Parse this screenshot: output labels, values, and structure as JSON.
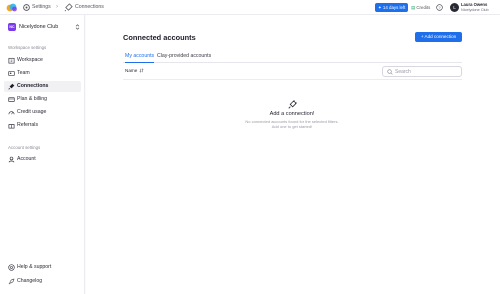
{
  "topbar": {
    "breadcrumb": [
      {
        "label": "Settings",
        "icon": "gear-icon"
      },
      {
        "label": "Connections",
        "icon": "plug-icon"
      }
    ],
    "days_left": "14 days left",
    "credits": "Credits",
    "user": {
      "initial": "L",
      "name": "Laura Owens",
      "org": "Nicelydone Club"
    }
  },
  "sidebar": {
    "workspace": {
      "badge": "NC",
      "name": "Nicelydone Club"
    },
    "workspace_section": "Workspace settings",
    "workspace_items": [
      {
        "label": "Workspace",
        "icon": "building-icon"
      },
      {
        "label": "Team",
        "icon": "team-icon"
      },
      {
        "label": "Connections",
        "icon": "plug-icon",
        "active": true
      },
      {
        "label": "Plan & billing",
        "icon": "card-icon"
      },
      {
        "label": "Credit usage",
        "icon": "gauge-icon"
      },
      {
        "label": "Referrals",
        "icon": "gift-icon"
      }
    ],
    "account_section": "Account settings",
    "account_items": [
      {
        "label": "Account",
        "icon": "user-icon"
      }
    ],
    "footer_items": [
      {
        "label": "Help & support",
        "icon": "help-icon"
      },
      {
        "label": "Changelog",
        "icon": "rocket-icon"
      }
    ]
  },
  "main": {
    "title": "Connected accounts",
    "add_button": "+ Add connection",
    "tabs": [
      {
        "label": "My accounts",
        "active": true
      },
      {
        "label": "Clay-provided accounts",
        "active": false
      }
    ],
    "sort_label": "Name",
    "search_placeholder": "Search",
    "empty": {
      "title": "Add a connection!",
      "line1": "No connected accounts found for the selected filters.",
      "line2": "Add one to get started!"
    }
  },
  "colors": {
    "accent": "#1f6feb",
    "workspace_badge": "#7c3aed"
  }
}
